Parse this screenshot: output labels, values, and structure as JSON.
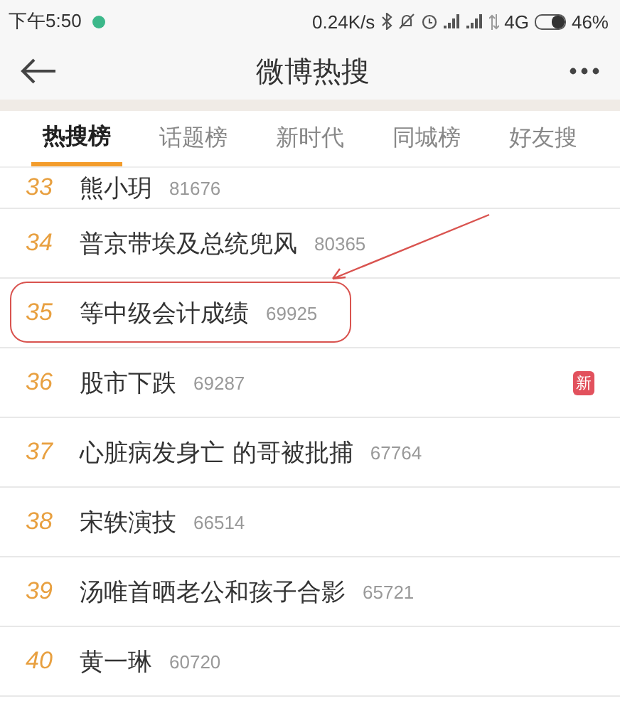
{
  "status_bar": {
    "time": "下午5:50",
    "speed": "0.24K/s",
    "network": "4G",
    "battery_text": "46%",
    "battery": {
      "level": 0.46
    }
  },
  "header": {
    "title": "微博热搜"
  },
  "tabs": [
    {
      "label": "热搜榜",
      "selected": true
    },
    {
      "label": "话题榜",
      "selected": false
    },
    {
      "label": "新时代",
      "selected": false
    },
    {
      "label": "同城榜",
      "selected": false
    },
    {
      "label": "好友搜",
      "selected": false
    }
  ],
  "rows": [
    {
      "rank": "33",
      "title": "熊小玥",
      "count": "81676",
      "circled": false
    },
    {
      "rank": "34",
      "title": "普京带埃及总统兜风",
      "count": "80365",
      "circled": false
    },
    {
      "rank": "35",
      "title": "等中级会计成绩",
      "count": "69925",
      "circled": true
    },
    {
      "rank": "36",
      "title": "股市下跌",
      "count": "69287",
      "circled": false,
      "badge": "新"
    },
    {
      "rank": "37",
      "title": "心脏病发身亡 的哥被批捕",
      "count": "67764",
      "circled": false
    },
    {
      "rank": "38",
      "title": "宋轶演技",
      "count": "66514",
      "circled": false
    },
    {
      "rank": "39",
      "title": "汤唯首晒老公和孩子合影",
      "count": "65721",
      "circled": false
    },
    {
      "rank": "40",
      "title": "黄一琳",
      "count": "60720",
      "circled": false
    }
  ]
}
